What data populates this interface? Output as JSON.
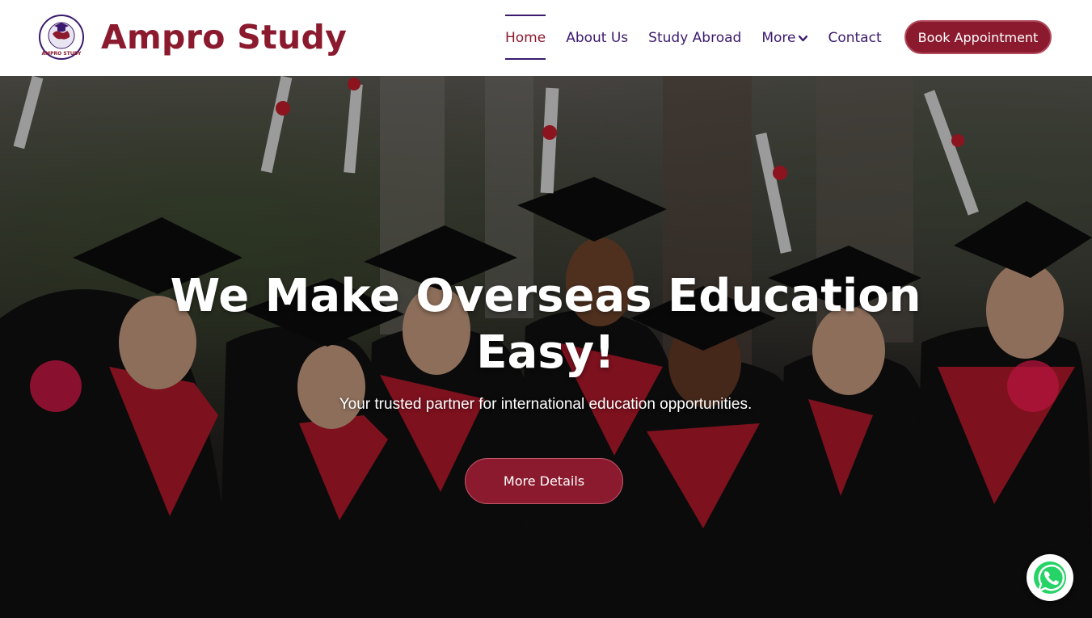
{
  "header": {
    "brand": "Ampro Study",
    "logo_text": "AMPRO STUDY",
    "book_button": "Book Appointment"
  },
  "nav": {
    "items": [
      {
        "label": "Home",
        "active": true
      },
      {
        "label": "About Us"
      },
      {
        "label": "Study Abroad"
      },
      {
        "label": "More",
        "has_dropdown": true
      },
      {
        "label": "Contact"
      }
    ]
  },
  "hero": {
    "title_line1": "We Make Overseas Education",
    "title_line2": "Easy!",
    "subtitle": "Your trusted partner for international education opportunities.",
    "cta": "More Details"
  },
  "colors": {
    "brand": "#8b1a2e",
    "nav_text": "#3b1a6e",
    "slider_arrow": "#b4143c"
  },
  "icons": {
    "logo": "globe-graduation-cap-icon",
    "dropdown": "chevron-down-icon",
    "whatsapp": "whatsapp-icon"
  }
}
